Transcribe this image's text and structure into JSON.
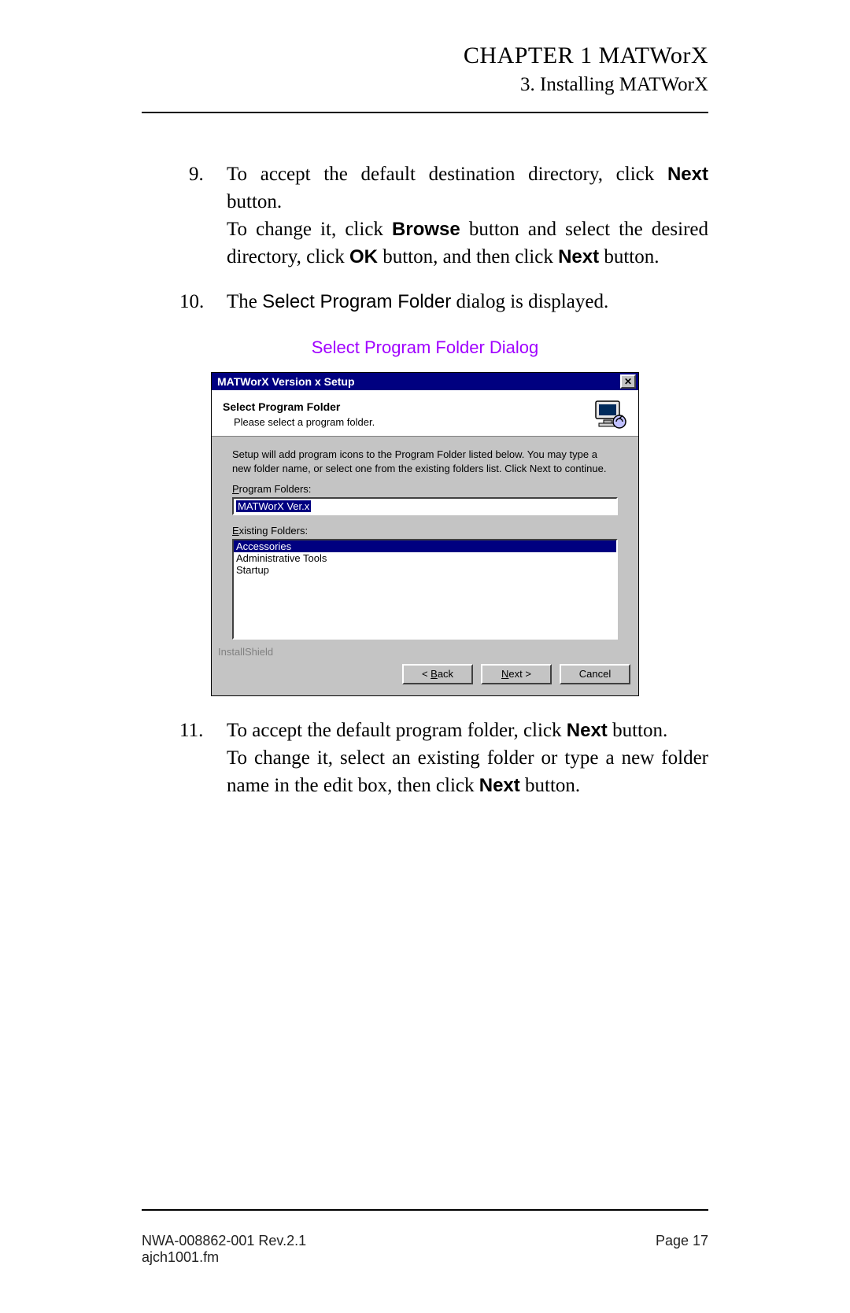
{
  "header": {
    "chapter": "CHAPTER 1 MATWorX",
    "section": "3. Installing MATWorX"
  },
  "steps": {
    "s9a_pre": "To accept the default destination directory, click ",
    "s9a_bold": "Next",
    "s9a_post": " button.",
    "s9b_pre": "To change it, click ",
    "s9b_bold1": "Browse",
    "s9b_mid1": " button and select the desired directory, click ",
    "s9b_bold2": "OK",
    "s9b_mid2": " button, and then click ",
    "s9b_bold3": "Next",
    "s9b_post": " button.",
    "s10_pre": "The ",
    "s10_sans": "Select Program Folder",
    "s10_post": " dialog is displayed.",
    "s11a_pre": "To accept the default program folder, click ",
    "s11a_bold": "Next",
    "s11a_post": " button.",
    "s11b_pre": "To change it, select an existing folder or type a new folder name in the edit box, then click ",
    "s11b_bold": "Next",
    "s11b_post": " button."
  },
  "figure_caption": "Select Program Folder Dialog",
  "dialog": {
    "title": "MATWorX  Version x Setup",
    "close_glyph": "✕",
    "header_title": "Select Program Folder",
    "header_sub": "Please select a program folder.",
    "description": "Setup will add program icons to the Program Folder listed below.  You may type a new folder name, or select one from the existing folders list.  Click Next to continue.",
    "label_program_pre": "P",
    "label_program_post": "rogram Folders:",
    "program_value": "MATWorX Ver.x",
    "label_existing_pre": "E",
    "label_existing_post": "xisting Folders:",
    "existing": {
      "i0": "Accessories",
      "i1": "Administrative Tools",
      "i2": "Startup"
    },
    "installshield": "InstallShield",
    "buttons": {
      "back_pre": "< ",
      "back_u": "B",
      "back_post": "ack",
      "next_u": "N",
      "next_post": "ext >",
      "cancel": "Cancel"
    }
  },
  "footer": {
    "doc": "NWA-008862-001 Rev.2.1",
    "file": "ajch1001.fm",
    "page": "Page 17"
  }
}
